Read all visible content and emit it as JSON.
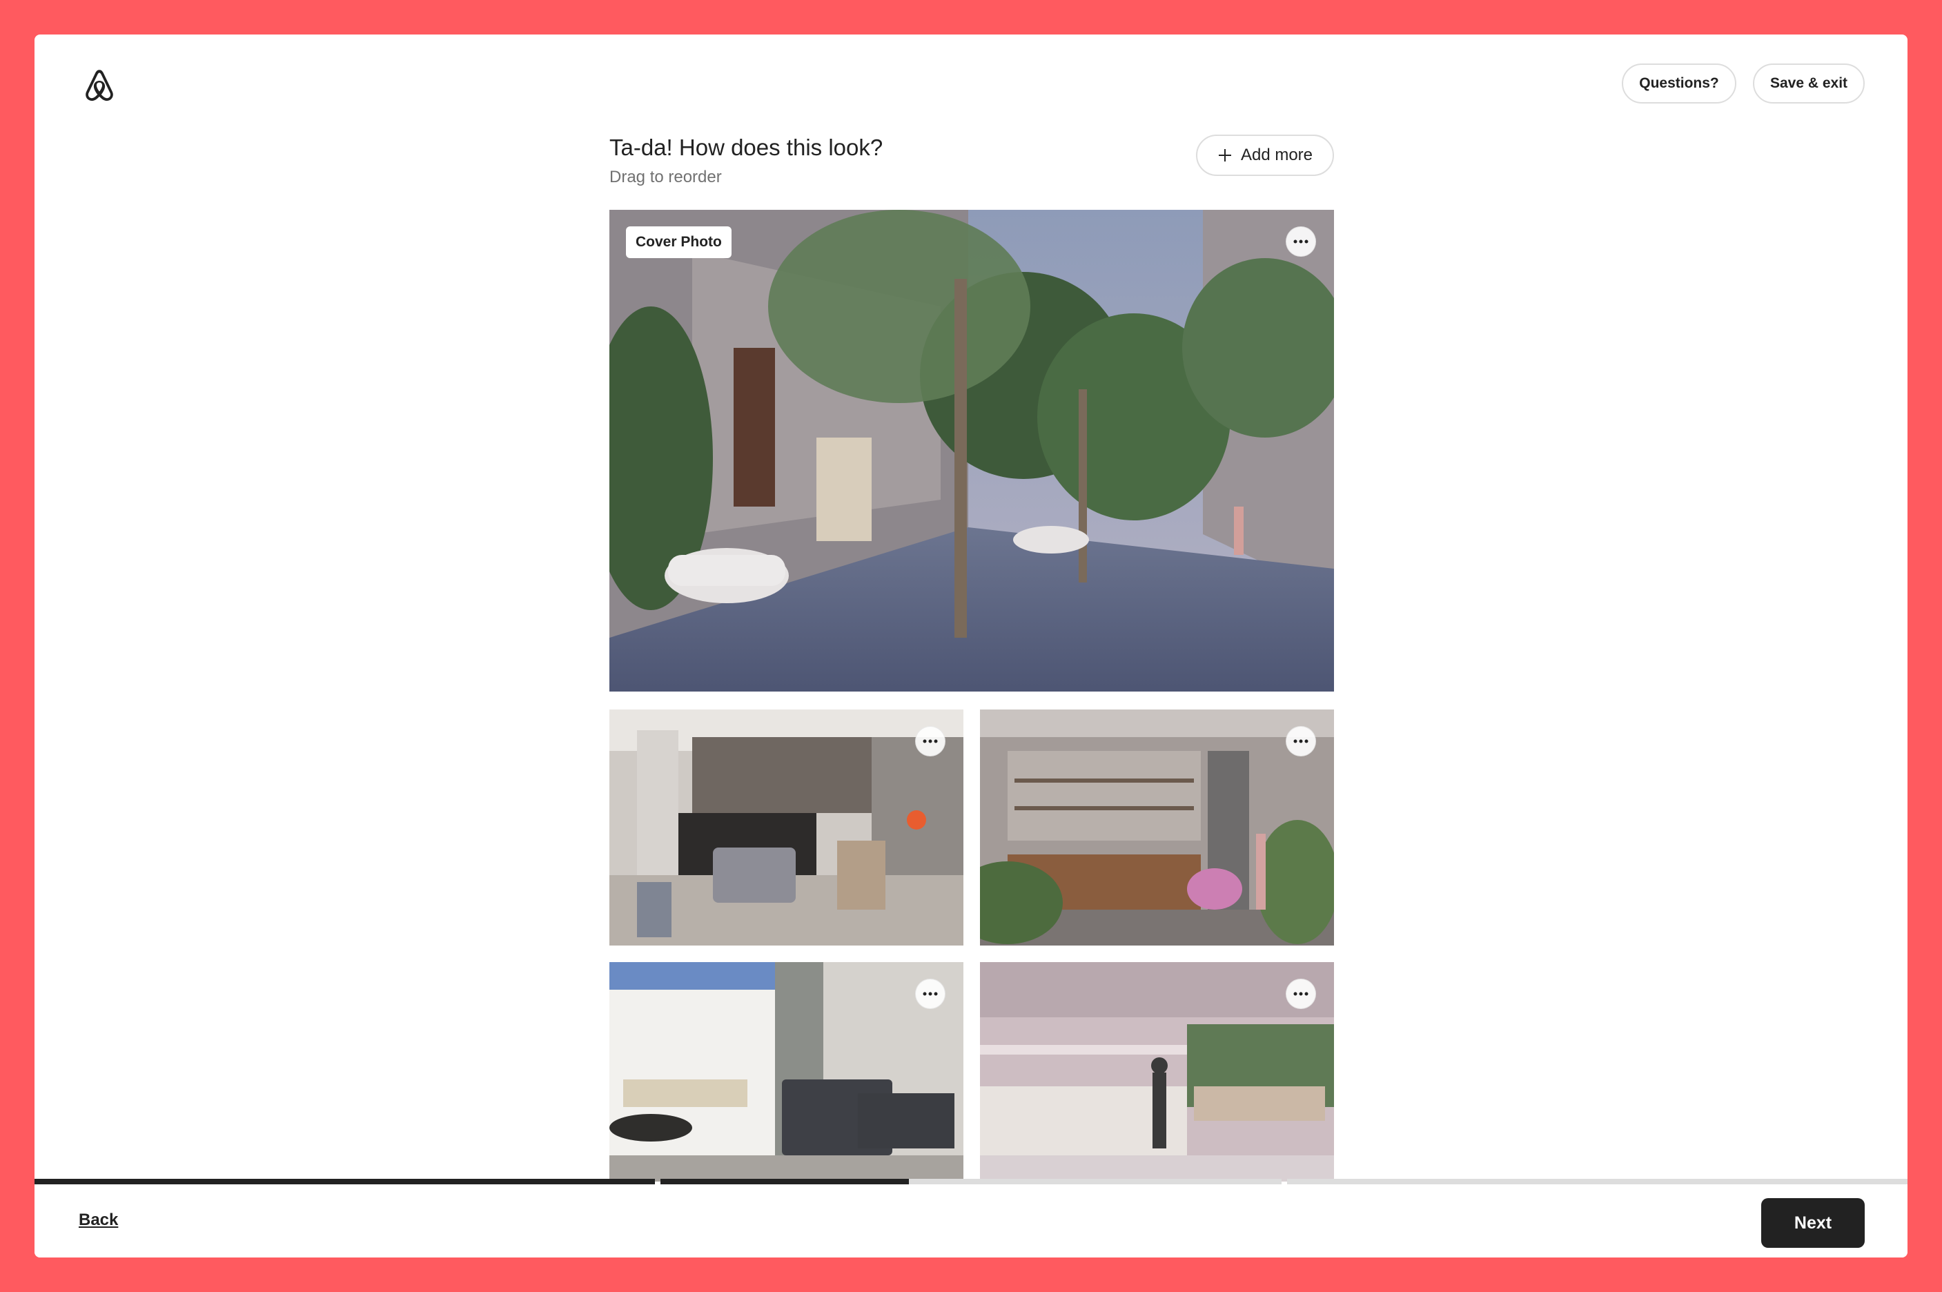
{
  "header": {
    "logo": "airbnb-logo",
    "questions_label": "Questions?",
    "save_exit_label": "Save & exit"
  },
  "main": {
    "title": "Ta-da! How does this look?",
    "subtitle": "Drag to reorder",
    "add_more_label": "Add more",
    "cover_badge": "Cover Photo",
    "photos": [
      {
        "description": "exterior-street-with-trees-and-cars",
        "is_cover": true
      },
      {
        "description": "living-room-and-kitchen",
        "is_cover": false
      },
      {
        "description": "outdoor-bar-lounge",
        "is_cover": false
      },
      {
        "description": "living-room-with-patio-pool",
        "is_cover": false
      },
      {
        "description": "kitchen-with-woman",
        "is_cover": false
      }
    ]
  },
  "progress": {
    "segments": [
      1.0,
      0.4,
      0.0
    ]
  },
  "footer": {
    "back_label": "Back",
    "next_label": "Next"
  },
  "colors": {
    "brand_frame": "#ff5a5f",
    "primary_dark": "#222222",
    "border": "#dddddd",
    "muted_text": "#717171"
  }
}
